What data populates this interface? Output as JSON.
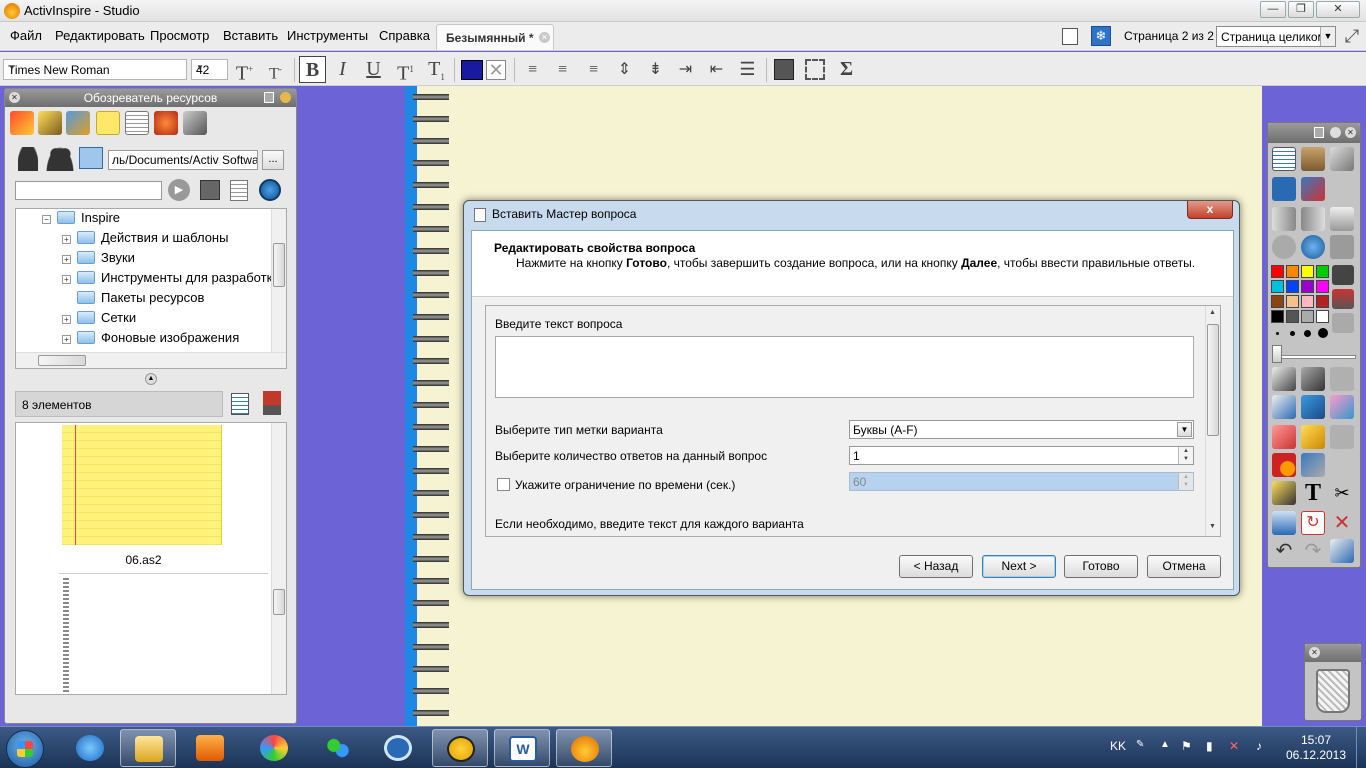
{
  "window": {
    "title": "ActivInspire - Studio"
  },
  "menu": [
    "Файл",
    "Редактировать",
    "Просмотр",
    "Вставить",
    "Инструменты",
    "Справка"
  ],
  "document_tab": {
    "label": "Безымянный *"
  },
  "page_info": "Страница 2 из 2",
  "zoom": {
    "selected": "Страница целиком"
  },
  "format": {
    "font": "Times New Roman",
    "size": "42"
  },
  "resource_browser": {
    "title": "Обозреватель ресурсов",
    "path": "ль/Documents/Activ Software",
    "browse_label": "...",
    "tree": [
      {
        "label": "Inspire",
        "level": 0,
        "expander": "−"
      },
      {
        "label": "Действия и шаблоны",
        "level": 1,
        "expander": "+"
      },
      {
        "label": "Звуки",
        "level": 1,
        "expander": "+"
      },
      {
        "label": "Инструменты для разработки",
        "level": 1,
        "expander": "+"
      },
      {
        "label": "Пакеты ресурсов",
        "level": 1,
        "expander": ""
      },
      {
        "label": "Сетки",
        "level": 1,
        "expander": "+"
      },
      {
        "label": "Фоновые изображения",
        "level": 1,
        "expander": "+"
      }
    ],
    "item_count": "8 элементов",
    "thumbnails": [
      {
        "label": "06.as2"
      }
    ]
  },
  "dialog": {
    "title": "Вставить Мастер вопроса",
    "header": "Редактировать свойства вопроса",
    "subheader_parts": [
      "Нажмите на кнопку ",
      "Готово",
      ", чтобы завершить создание вопроса, или на кнопку ",
      "Далее",
      ", чтобы ввести правильные ответы."
    ],
    "question_label": "Введите текст вопроса",
    "label_type_label": "Выберите тип метки варианта",
    "label_type_value": "Буквы (A-F)",
    "answers_count_label": "Выберите количество ответов на данный вопрос",
    "answers_count_value": "1",
    "time_limit_label": "Укажите ограничение по времени (сек.)",
    "time_limit_checked": false,
    "time_limit_value": "60",
    "options_label": "Если необходимо, введите текст для каждого варианта",
    "buttons": {
      "back": "< Назад",
      "next": "Next >",
      "finish": "Готово",
      "cancel": "Отмена"
    },
    "close": "x"
  },
  "palette_colors": [
    "#ff0000",
    "#ff8800",
    "#ffff00",
    "#00cc00",
    "#00c0e0",
    "#0044ff",
    "#9900cc",
    "#ff00ff",
    "#8b4513",
    "#f5c08a",
    "#ffb6c1",
    "#b22222",
    "#000000",
    "#555555",
    "#aaaaaa",
    "#ffffff"
  ],
  "taskbar": {
    "lang": "KK",
    "time": "15:07",
    "date": "06.12.2013"
  }
}
